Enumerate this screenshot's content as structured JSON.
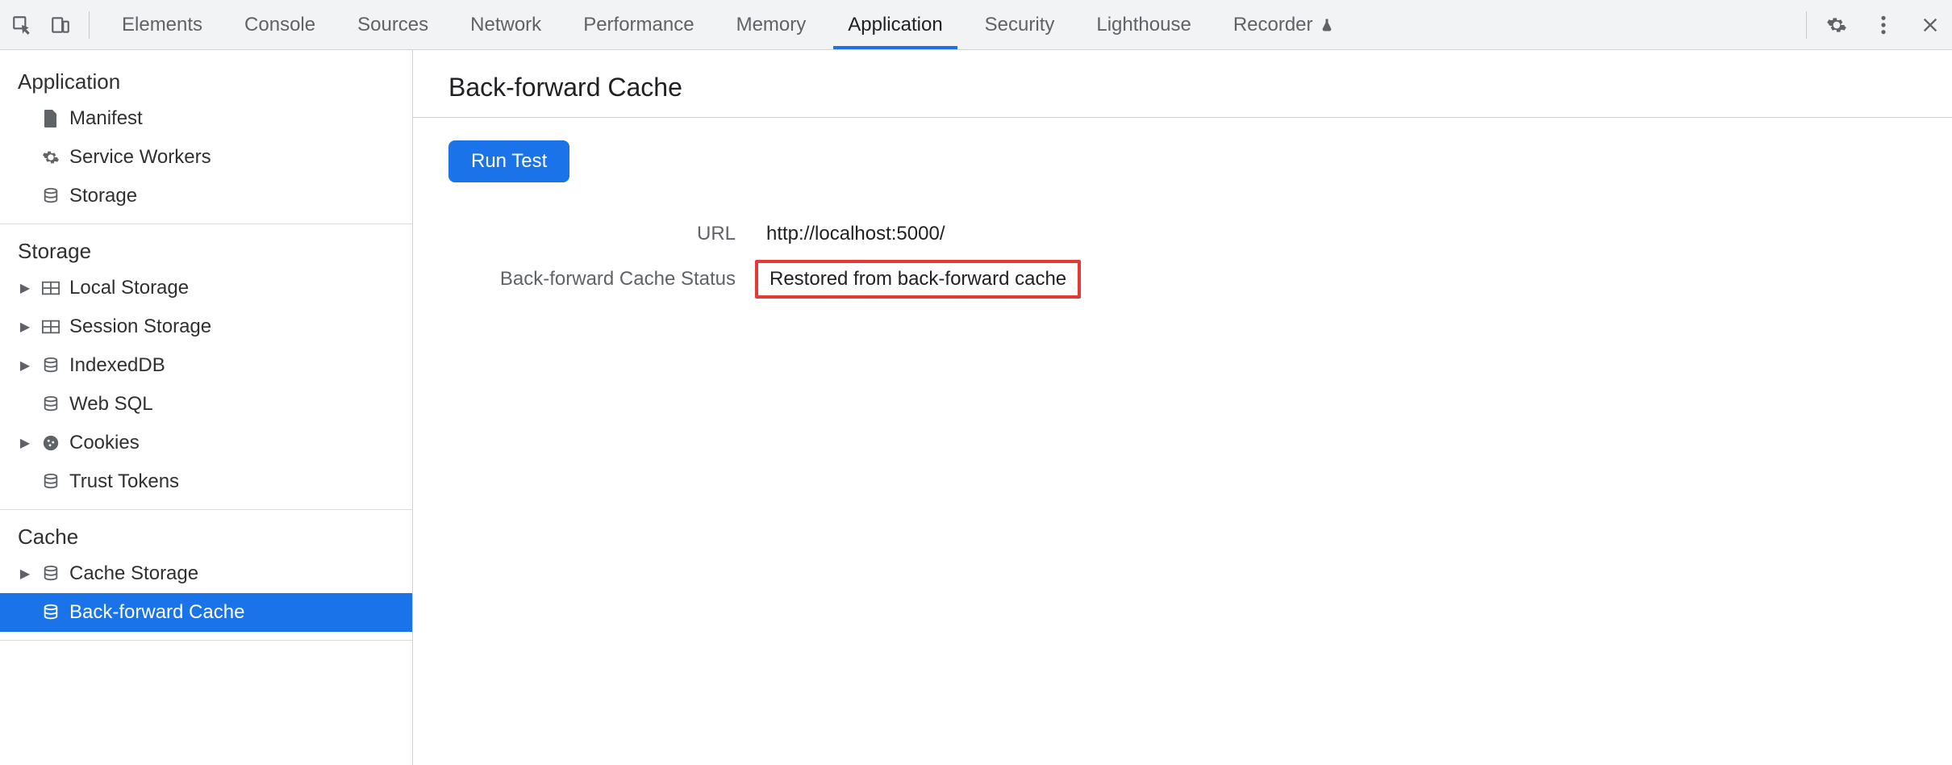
{
  "topbar": {
    "tabs": [
      {
        "id": "elements",
        "label": "Elements",
        "active": false
      },
      {
        "id": "console",
        "label": "Console",
        "active": false
      },
      {
        "id": "sources",
        "label": "Sources",
        "active": false
      },
      {
        "id": "network",
        "label": "Network",
        "active": false
      },
      {
        "id": "performance",
        "label": "Performance",
        "active": false
      },
      {
        "id": "memory",
        "label": "Memory",
        "active": false
      },
      {
        "id": "application",
        "label": "Application",
        "active": true
      },
      {
        "id": "security",
        "label": "Security",
        "active": false
      },
      {
        "id": "lighthouse",
        "label": "Lighthouse",
        "active": false
      },
      {
        "id": "recorder",
        "label": "Recorder",
        "active": false
      }
    ]
  },
  "sidebar": {
    "groups": [
      {
        "title": "Application",
        "items": [
          {
            "id": "manifest",
            "label": "Manifest",
            "icon": "file",
            "expandable": false
          },
          {
            "id": "service-workers",
            "label": "Service Workers",
            "icon": "gear",
            "expandable": false
          },
          {
            "id": "storage-app",
            "label": "Storage",
            "icon": "storage",
            "expandable": false
          }
        ]
      },
      {
        "title": "Storage",
        "items": [
          {
            "id": "local-storage",
            "label": "Local Storage",
            "icon": "grid",
            "expandable": true
          },
          {
            "id": "session-storage",
            "label": "Session Storage",
            "icon": "grid",
            "expandable": true
          },
          {
            "id": "indexeddb",
            "label": "IndexedDB",
            "icon": "storage",
            "expandable": true
          },
          {
            "id": "web-sql",
            "label": "Web SQL",
            "icon": "storage",
            "expandable": false
          },
          {
            "id": "cookies",
            "label": "Cookies",
            "icon": "cookie",
            "expandable": true
          },
          {
            "id": "trust-tokens",
            "label": "Trust Tokens",
            "icon": "storage",
            "expandable": false
          }
        ]
      },
      {
        "title": "Cache",
        "items": [
          {
            "id": "cache-storage",
            "label": "Cache Storage",
            "icon": "storage",
            "expandable": true
          },
          {
            "id": "bfcache",
            "label": "Back-forward Cache",
            "icon": "storage",
            "expandable": false,
            "selected": true
          }
        ]
      }
    ]
  },
  "content": {
    "title": "Back-forward Cache",
    "run_test_label": "Run Test",
    "rows": [
      {
        "key": "URL",
        "value": "http://localhost:5000/",
        "highlight": false
      },
      {
        "key": "Back-forward Cache Status",
        "value": "Restored from back-forward cache",
        "highlight": true
      }
    ]
  }
}
